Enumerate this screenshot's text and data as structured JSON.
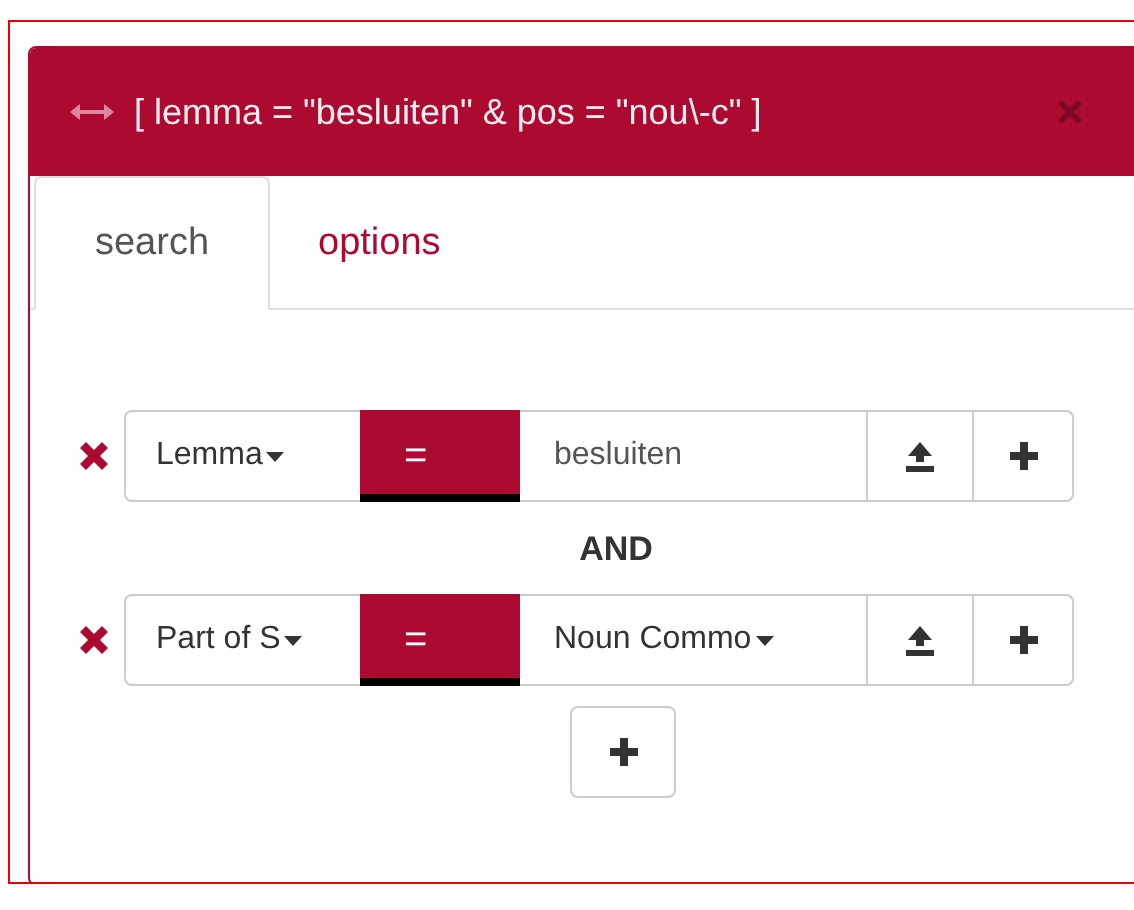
{
  "panel": {
    "title": "[ lemma = \"besluiten\" & pos = \"nou\\-c\" ]"
  },
  "tabs": [
    {
      "label": "search",
      "selected": true
    },
    {
      "label": "options",
      "selected": false
    }
  ],
  "clauses": [
    {
      "field": "Lemma",
      "operator": "=",
      "kind": "text",
      "value": "besluiten"
    },
    {
      "field": "Part of S",
      "operator": "=",
      "kind": "select",
      "value": "Noun Commo"
    }
  ],
  "connectors": [
    "AND"
  ]
}
